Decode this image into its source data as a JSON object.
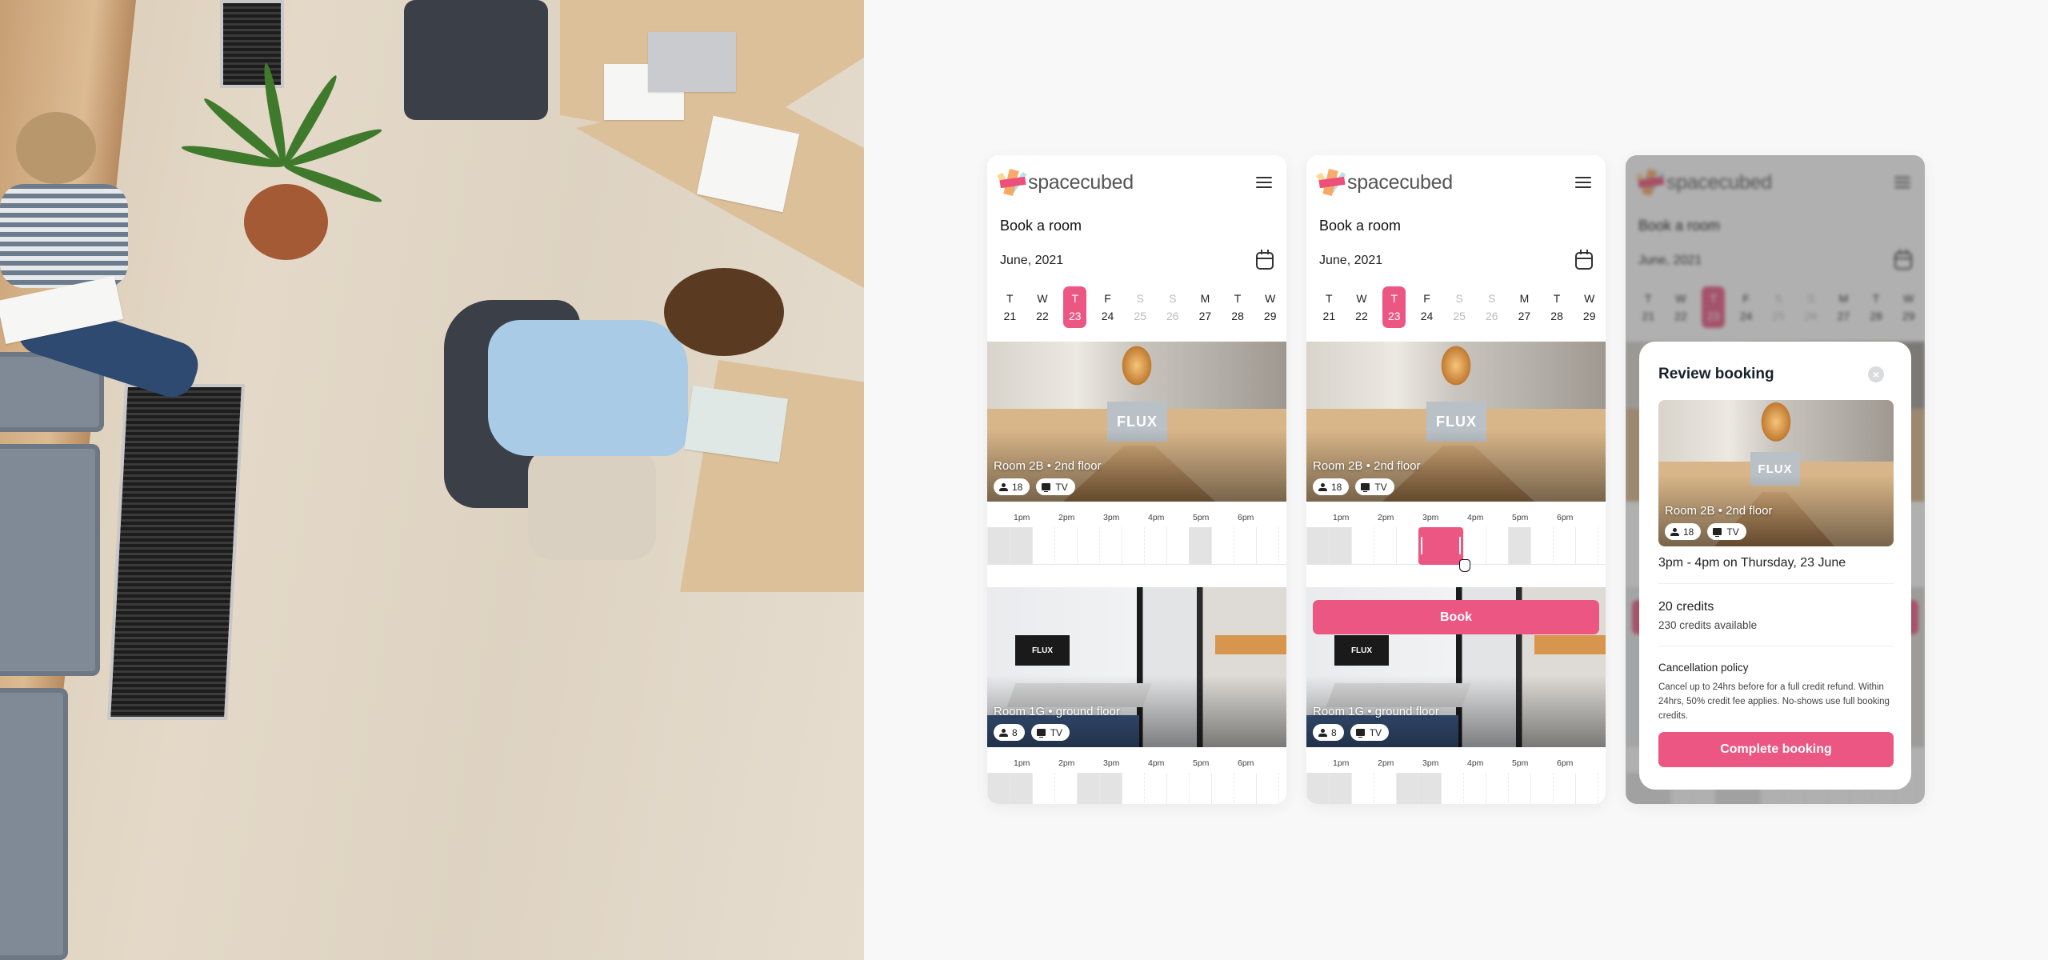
{
  "brand": {
    "name": "spacecubed",
    "accent": "#ec5683"
  },
  "header": {
    "title": "Book a room",
    "month": "June, 2021"
  },
  "days": [
    {
      "letter": "T",
      "num": "21",
      "weekend": false,
      "selected": false
    },
    {
      "letter": "W",
      "num": "22",
      "weekend": false,
      "selected": false
    },
    {
      "letter": "T",
      "num": "23",
      "weekend": false,
      "selected": true
    },
    {
      "letter": "F",
      "num": "24",
      "weekend": false,
      "selected": false
    },
    {
      "letter": "S",
      "num": "25",
      "weekend": true,
      "selected": false
    },
    {
      "letter": "S",
      "num": "26",
      "weekend": true,
      "selected": false
    },
    {
      "letter": "M",
      "num": "27",
      "weekend": false,
      "selected": false
    },
    {
      "letter": "T",
      "num": "28",
      "weekend": false,
      "selected": false
    },
    {
      "letter": "W",
      "num": "29",
      "weekend": false,
      "selected": false
    }
  ],
  "timeline": {
    "hour_labels": [
      "1pm",
      "2pm",
      "3pm",
      "4pm",
      "5pm",
      "6pm"
    ],
    "slot_starts": [
      "12:30",
      "1:00",
      "1:30",
      "2:00",
      "2:30",
      "3:00",
      "3:30",
      "4:00",
      "4:30",
      "5:00",
      "5:30",
      "6:00",
      "6:30",
      "7:00"
    ]
  },
  "rooms": [
    {
      "name": "Room 2B • 2nd floor",
      "capacity": "18",
      "amenity": "TV",
      "photo_label": "FLUX",
      "busy_slots": [
        "12:30",
        "1:00",
        "5:00"
      ]
    },
    {
      "name": "Room 1G • ground floor",
      "capacity": "8",
      "amenity": "TV",
      "photo_label": "FLUX",
      "busy_slots": [
        "12:30",
        "1:00",
        "2:30",
        "3:00"
      ]
    }
  ],
  "selection": {
    "room_index": 0,
    "start": "3:00",
    "end": "4:00"
  },
  "book_button": "Book",
  "review": {
    "title": "Review booking",
    "close_label": "×",
    "room_name": "Room 2B • 2nd floor",
    "capacity": "18",
    "amenity": "TV",
    "photo_label": "FLUX",
    "when": "3pm - 4pm on Thursday, 23 June",
    "credits": "20 credits",
    "credits_available": "230 credits available",
    "policy_heading": "Cancellation policy",
    "policy_text": "Cancel up to 24hrs before for a full credit refund. Within 24hrs, 50% credit fee applies. No-shows use full booking credits.",
    "complete_button": "Complete booking"
  }
}
